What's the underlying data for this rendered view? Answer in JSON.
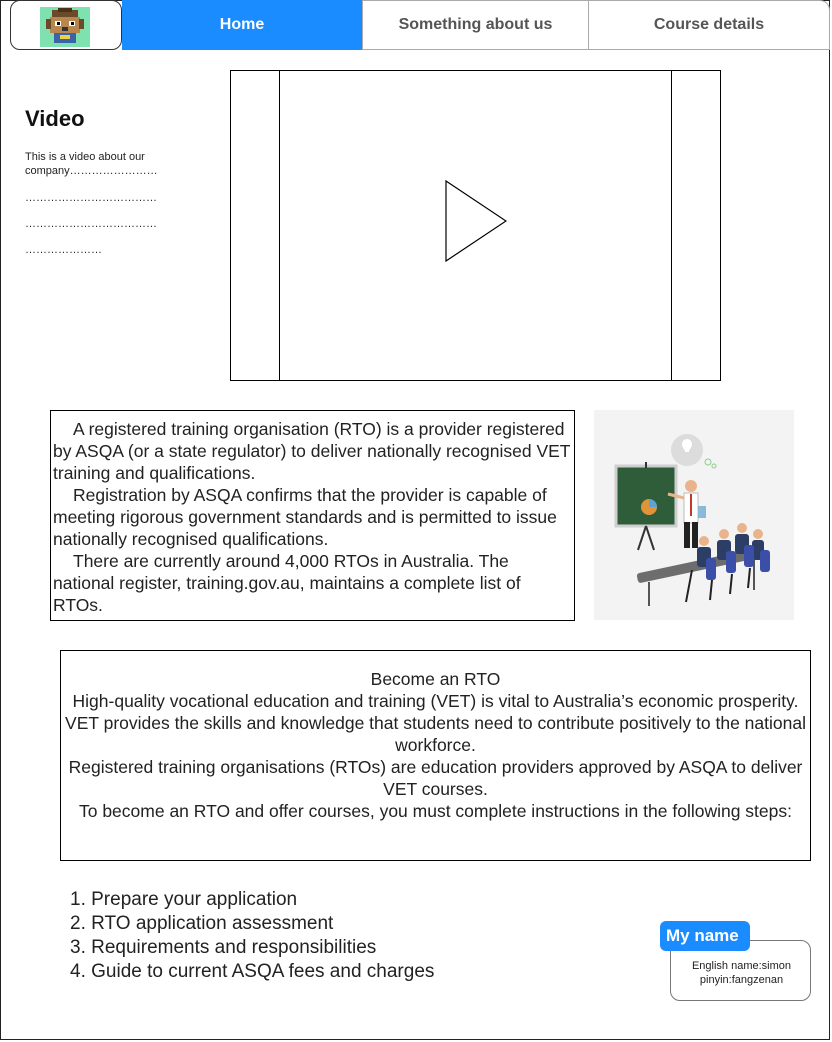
{
  "nav": {
    "tabs": [
      {
        "label": "Home"
      },
      {
        "label": "Something about us"
      },
      {
        "label": "Course details"
      }
    ]
  },
  "video_section": {
    "title": "Video",
    "description": "This is a video about our company……………………",
    "dot_lines": [
      "………………………………",
      "………………………………",
      "…………………"
    ]
  },
  "rto_info": {
    "paragraphs": [
      "A registered training organisation (RTO) is a provider registered by ASQA (or a state regulator) to deliver nationally recognised VET training and qualifications.",
      "Registration by ASQA confirms that the provider is capable of meeting rigorous government standards and is permitted to issue nationally recognised qualifications.",
      "There are currently around 4,000 RTOs in Australia. The national register, training.gov.au, maintains a complete list of RTOs."
    ]
  },
  "become_rto": {
    "lines": [
      "Become an RTO",
      "High-quality vocational education and training (VET) is vital to Australia’s economic prosperity. VET provides the skills and knowledge that students need to contribute positively to the national workforce.",
      "Registered training organisations (RTOs) are education providers approved by ASQA to deliver VET courses.",
      "To become an RTO and offer courses, you must complete instructions in the following steps:"
    ]
  },
  "steps": [
    "1. Prepare your application",
    "2. RTO application assessment",
    "3. Requirements and responsibilities",
    "4. Guide to current ASQA fees and charges"
  ],
  "name_card": {
    "tag": "My name",
    "english_name": "English name:simon",
    "pinyin": "pinyin:fangzenan"
  },
  "colors": {
    "accent": "#1a8cff"
  }
}
